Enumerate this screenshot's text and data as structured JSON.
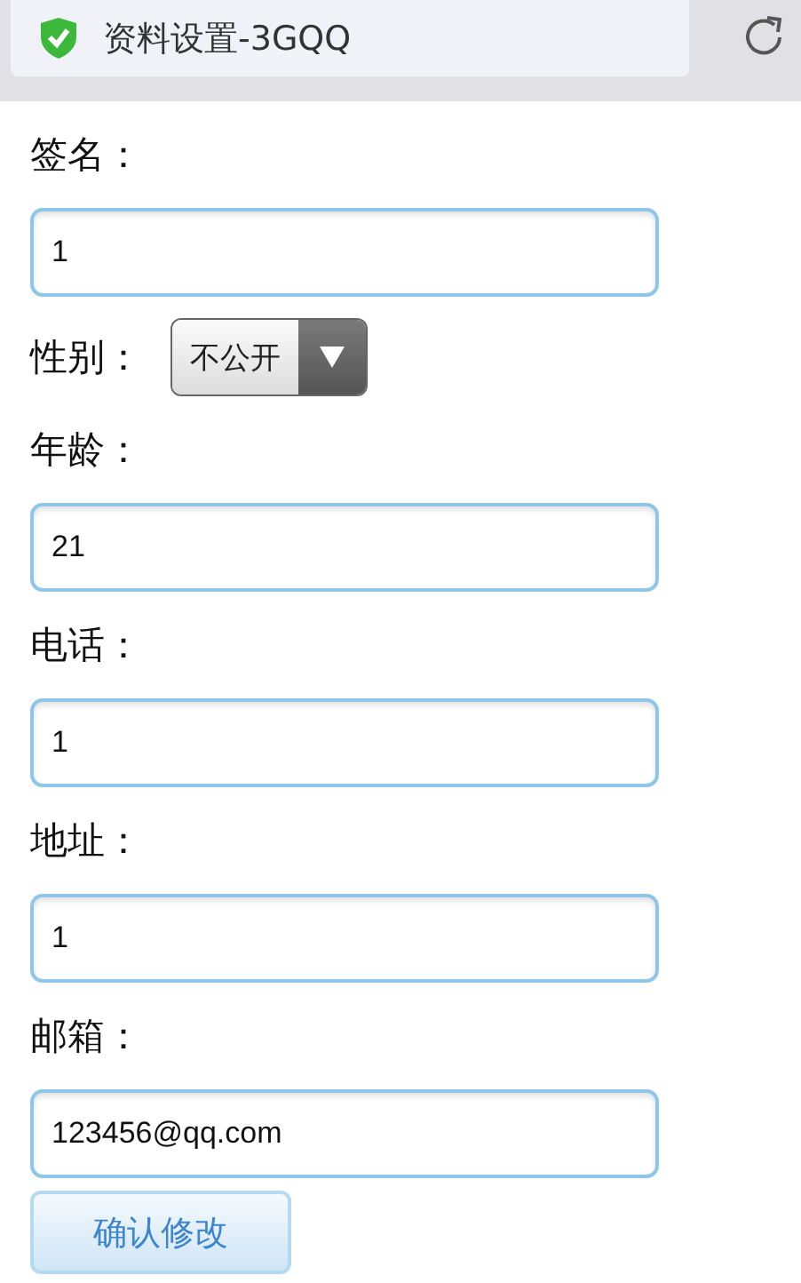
{
  "browser_bar": {
    "title": "资料设置-3GQQ"
  },
  "fields": [
    {
      "kind": "text",
      "label": "签名：",
      "value": "1"
    },
    {
      "kind": "select",
      "label": "性别：",
      "value": "不公开"
    },
    {
      "kind": "text",
      "label": "年龄：",
      "value": "21"
    },
    {
      "kind": "text",
      "label": "电话：",
      "value": "1"
    },
    {
      "kind": "text",
      "label": "地址：",
      "value": "1"
    },
    {
      "kind": "text",
      "label": "邮箱：",
      "value": "123456@qq.com"
    }
  ],
  "submit_button": "确认修改"
}
